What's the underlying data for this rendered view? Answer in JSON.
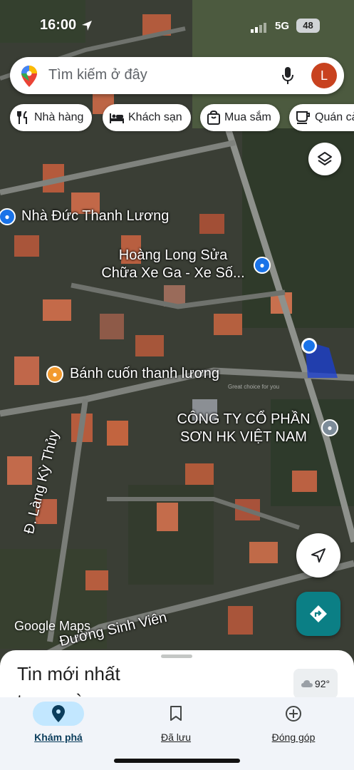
{
  "status_bar": {
    "time": "16:00",
    "network": "5G",
    "battery": "48"
  },
  "search": {
    "placeholder": "Tìm kiếm ở đây",
    "avatar_letter": "L"
  },
  "chips": [
    {
      "label": "Nhà hàng",
      "icon": "fork-knife-icon"
    },
    {
      "label": "Khách sạn",
      "icon": "bed-icon"
    },
    {
      "label": "Mua sắm",
      "icon": "shopping-bag-icon"
    },
    {
      "label": "Quán cà",
      "icon": "coffee-cup-icon"
    }
  ],
  "map": {
    "labels": {
      "nha_duc": "Nhà Đức Thanh Lương",
      "hoang_long_1": "Hoàng Long Sửa",
      "hoang_long_2": "Chữa Xe Ga - Xe Số...",
      "banh_cuon": "Bánh cuốn thanh lương",
      "cong_ty_1": "CÔNG TY CỔ PHẦN",
      "cong_ty_2": "SƠN HK VIỆT NAM",
      "lang_ky_thuy": "Đ. Làng Kỳ Thủy",
      "sinh_vien": "Đường Sinh Viên"
    },
    "watermark": "Great choice for you",
    "google_logo": "Google Maps",
    "colors": {
      "location_dot": "#1a73e8",
      "poi_blue": "#1a73e8",
      "poi_orange": "#f29a2e",
      "poi_gray": "#7d8c99"
    }
  },
  "bottom_sheet": {
    "title": "Tin mới nhất trong vùng",
    "weather": "92°"
  },
  "nav": [
    {
      "label": "Khám phá",
      "icon": "location-pin-icon",
      "active": true
    },
    {
      "label": "Đã lưu",
      "icon": "bookmark-icon",
      "active": false
    },
    {
      "label": "Đóng góp",
      "icon": "add-circle-icon",
      "active": false
    }
  ],
  "colors": {
    "accent": "#1a73e8",
    "directions_button": "#0b7f85",
    "nav_active_pill": "#c2e7ff",
    "avatar": "#c8421f"
  }
}
